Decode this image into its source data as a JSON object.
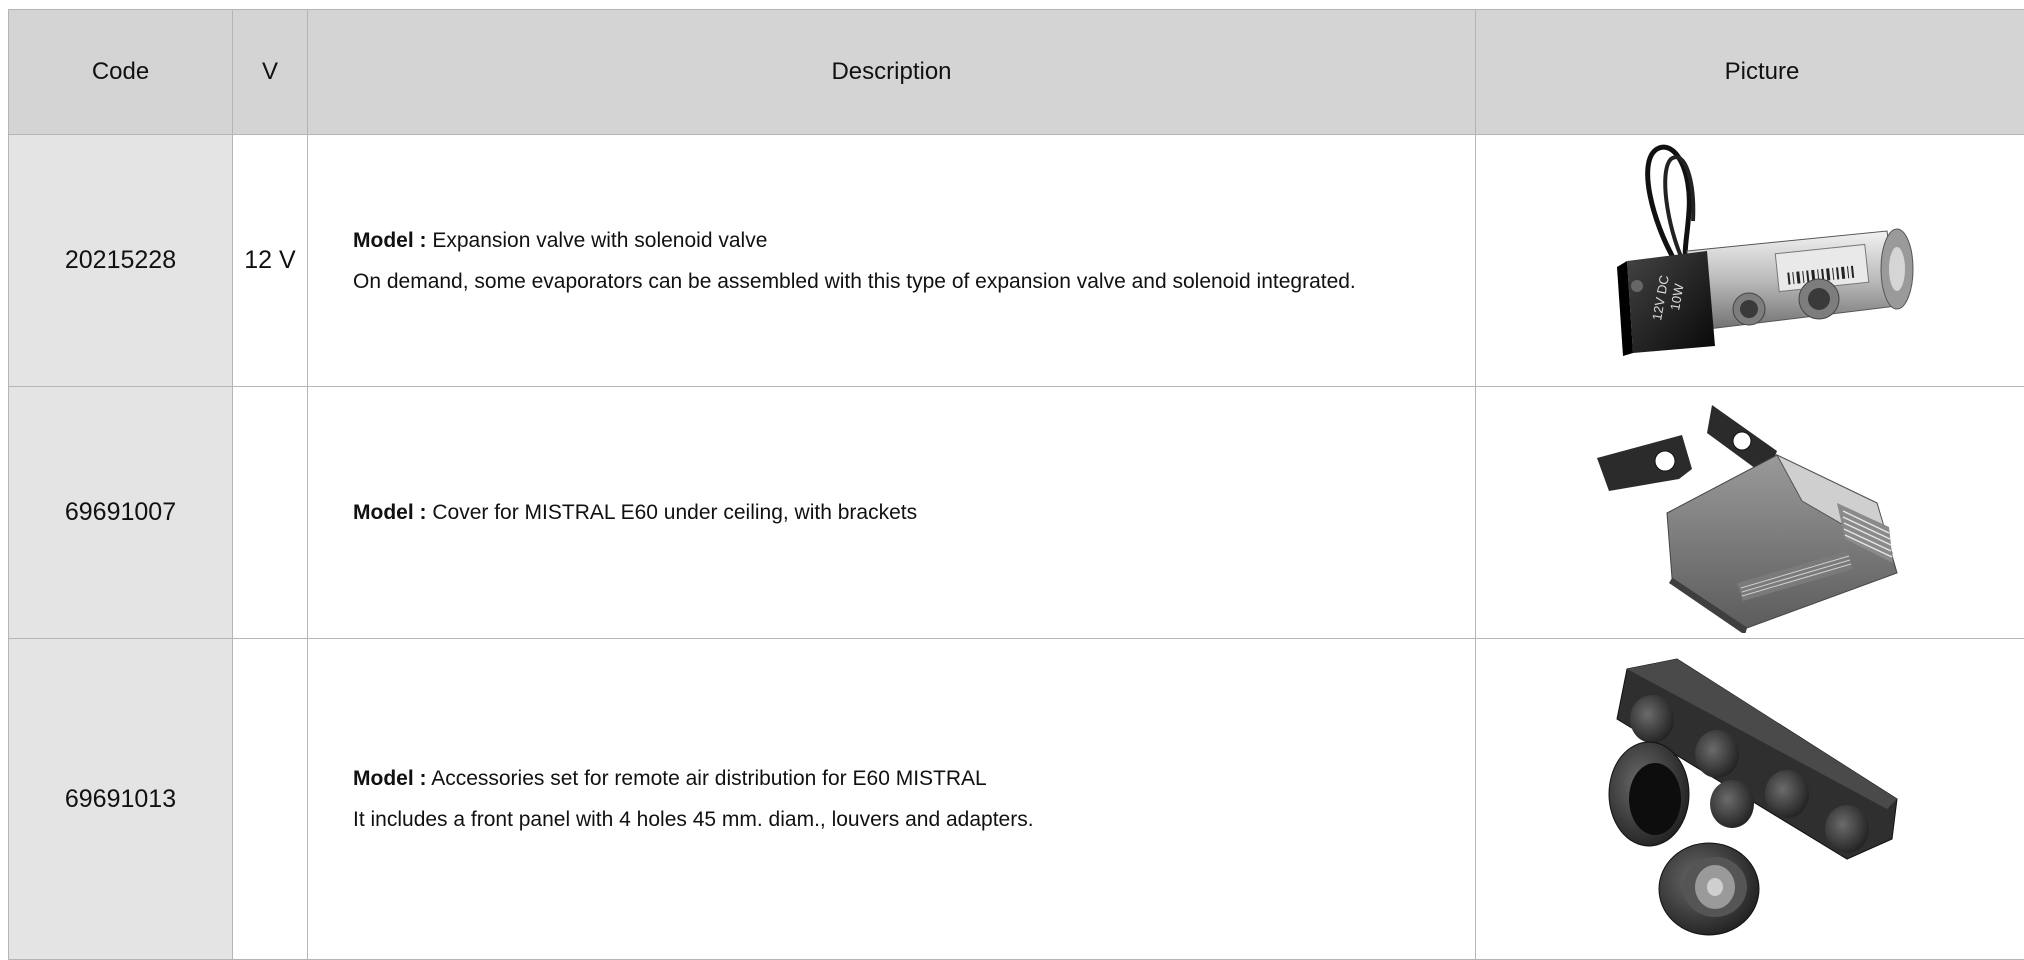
{
  "table": {
    "headers": {
      "code": "Code",
      "v": "V",
      "description": "Description",
      "picture": "Picture"
    },
    "rows": [
      {
        "code": "20215228",
        "voltage": "12 V",
        "model_label": "Model :",
        "model_text": "Expansion valve with solenoid valve",
        "note": "On demand, some evaporators can be assembled with this type of expansion valve and solenoid integrated.",
        "picture": "expansion-valve-image",
        "picture_labels": [
          "12V DC",
          "10W"
        ]
      },
      {
        "code": "69691007",
        "voltage": "",
        "model_label": "Model :",
        "model_text": "Cover for MISTRAL E60 under ceiling, with brackets",
        "note": "",
        "picture": "ceiling-cover-image"
      },
      {
        "code": "69691013",
        "voltage": "",
        "model_label": "Model :",
        "model_text": "Accessories set for remote air distribution for E60 MISTRAL",
        "note": "It includes a front panel with 4 holes 45 mm. diam., louvers and adapters.",
        "picture": "air-distribution-set-image"
      }
    ]
  }
}
